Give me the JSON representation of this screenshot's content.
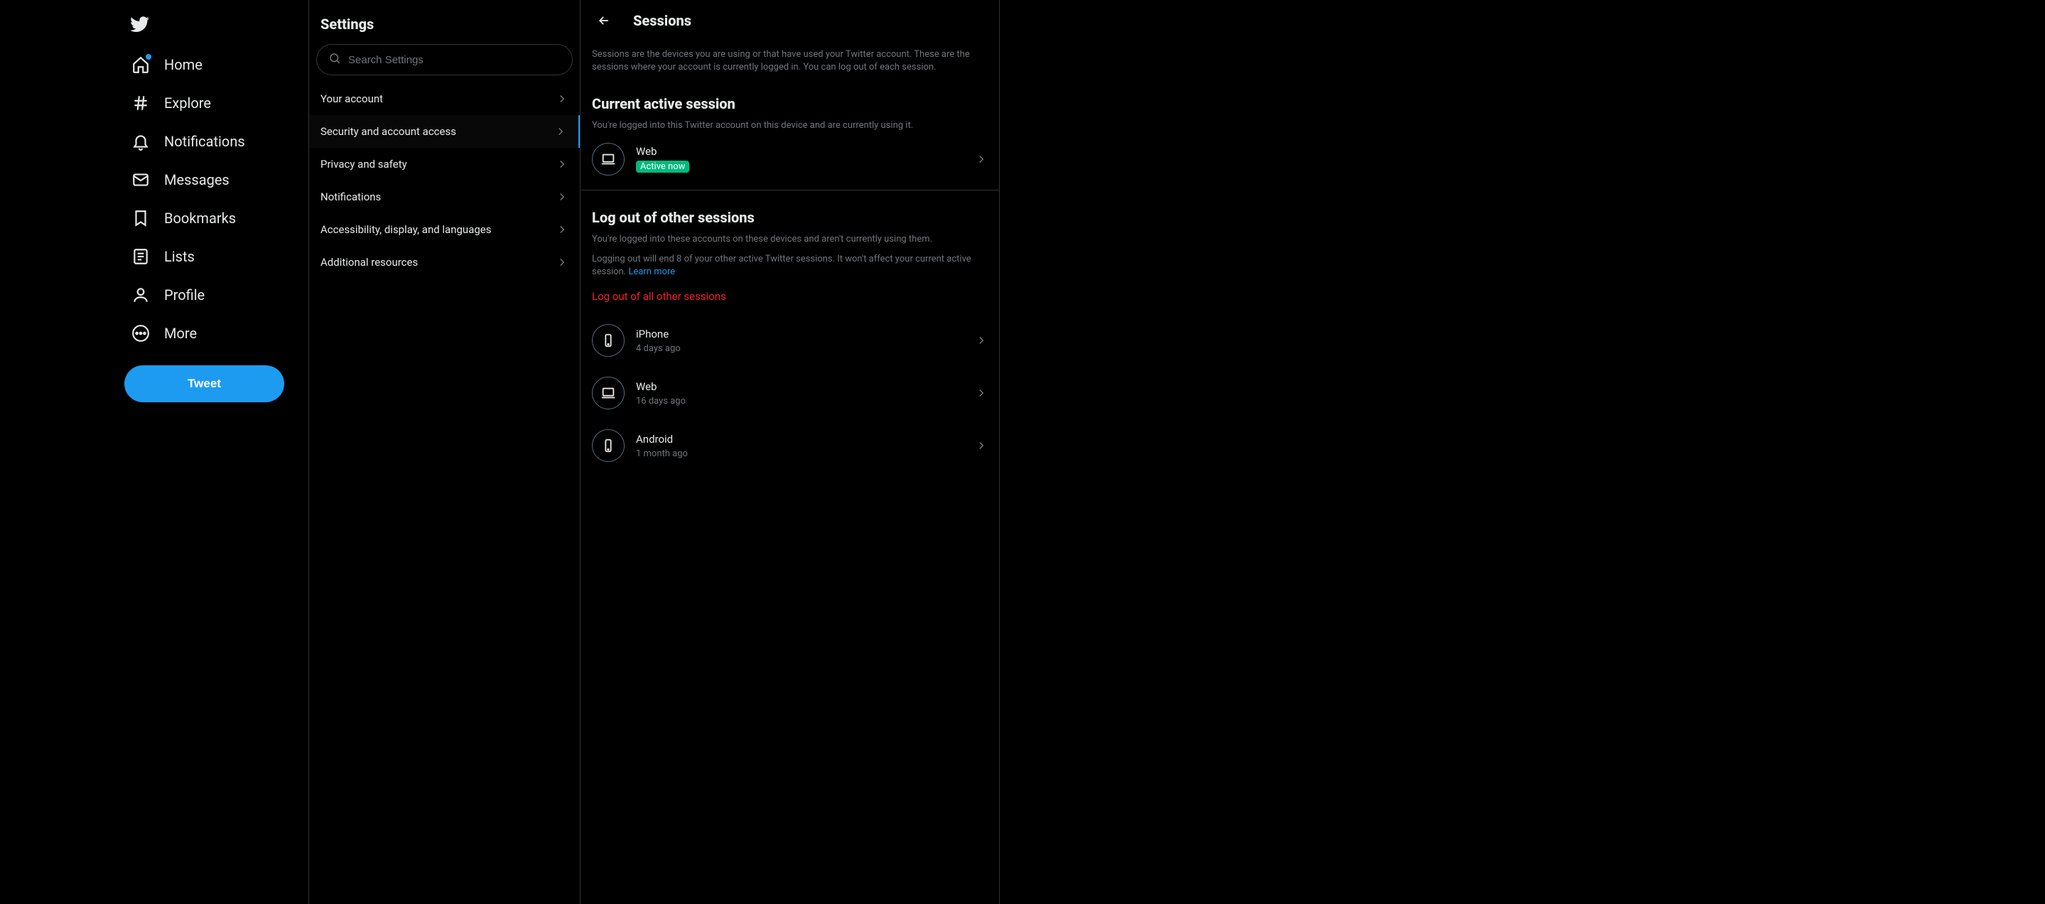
{
  "sidebar": {
    "items": [
      {
        "label": "Home"
      },
      {
        "label": "Explore"
      },
      {
        "label": "Notifications"
      },
      {
        "label": "Messages"
      },
      {
        "label": "Bookmarks"
      },
      {
        "label": "Lists"
      },
      {
        "label": "Profile"
      },
      {
        "label": "More"
      }
    ],
    "tweet_label": "Tweet"
  },
  "settings": {
    "title": "Settings",
    "search_placeholder": "Search Settings",
    "items": [
      {
        "label": "Your account"
      },
      {
        "label": "Security and account access"
      },
      {
        "label": "Privacy and safety"
      },
      {
        "label": "Notifications"
      },
      {
        "label": "Accessibility, display, and languages"
      },
      {
        "label": "Additional resources"
      }
    ]
  },
  "detail": {
    "title": "Sessions",
    "description": "Sessions are the devices you are using or that have used your Twitter account. These are the sessions where your account is currently logged in. You can log out of each session.",
    "current_section_title": "Current active session",
    "current_section_desc": "You're logged into this Twitter account on this device and are currently using it.",
    "current_session": {
      "name": "Web",
      "status": "Active now"
    },
    "other_section_title": "Log out of other sessions",
    "other_section_desc1": "You're logged into these accounts on these devices and aren't currently using them.",
    "other_section_desc2": "Logging out will end 8 of your other active Twitter sessions. It won't affect your current active session. ",
    "learn_more_label": "Learn more",
    "logout_all_label": "Log out of all other sessions",
    "other_sessions": [
      {
        "name": "iPhone",
        "meta": "4 days ago",
        "device": "phone"
      },
      {
        "name": "Web",
        "meta": "16 days ago",
        "device": "laptop"
      },
      {
        "name": "Android",
        "meta": "1 month ago",
        "device": "phone"
      }
    ]
  }
}
